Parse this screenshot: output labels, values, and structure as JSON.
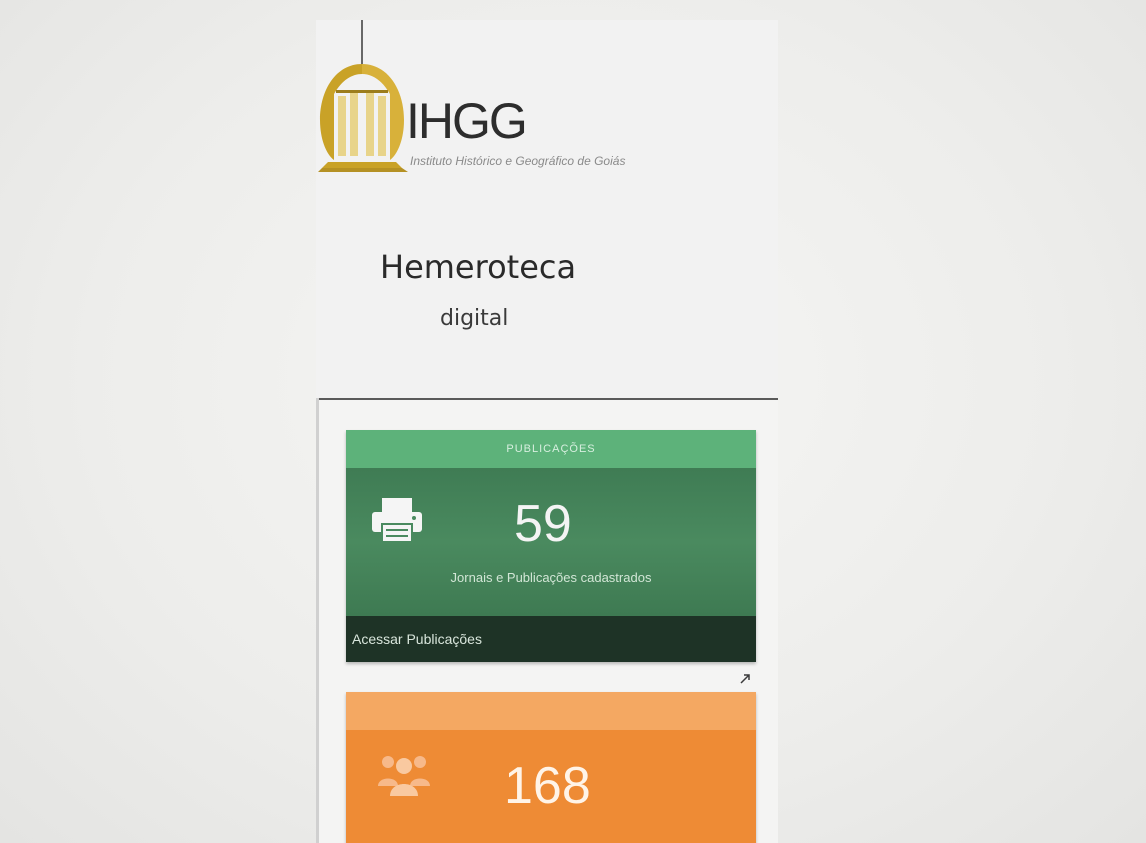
{
  "brand": {
    "logo_text": "IHGG",
    "logo_subtitle": "Instituto Histórico e Geográfico de Goiás",
    "logo_icon": "building-columns-icon"
  },
  "heading": {
    "title": "Hemeroteca",
    "subtitle": "digital"
  },
  "cards": [
    {
      "header": "Publicações",
      "value": "59",
      "caption": "Jornais e Publicações cadastrados",
      "footer_link": "Acessar Publicações",
      "icon": "printer-icon",
      "color": "#4a8a5f"
    },
    {
      "header": "",
      "value": "168",
      "caption": "",
      "icon": "users-icon",
      "color": "#ee8b35"
    }
  ],
  "colors": {
    "gold": "#c9a227",
    "green_header": "#5db27a",
    "green_body": "#4a8a5f",
    "green_footer": "#1e3326",
    "orange_header": "#f4a862",
    "orange_body": "#ee8b35"
  }
}
